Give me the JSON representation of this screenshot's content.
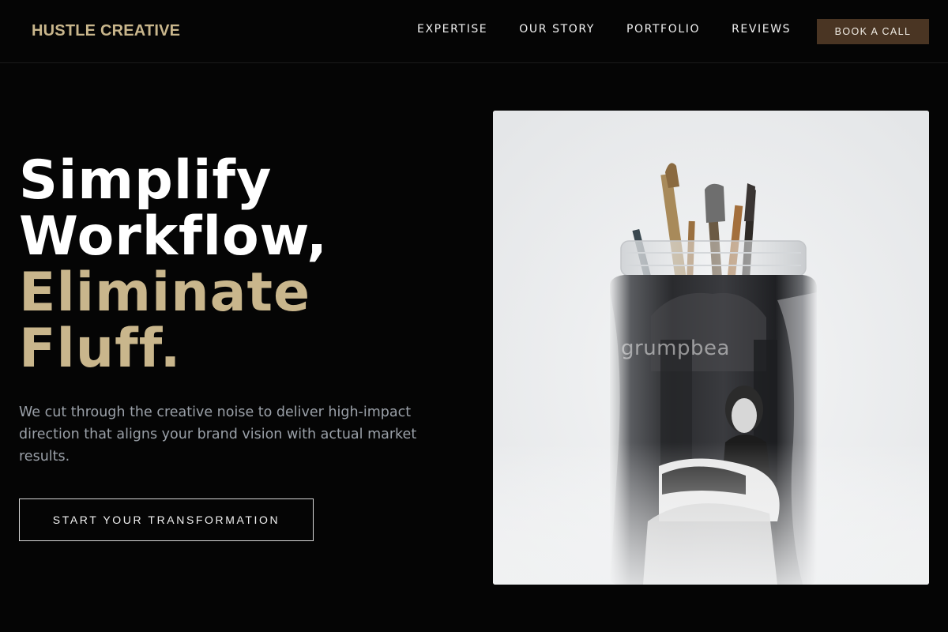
{
  "brand": {
    "name": "HUSTLE CREATIVE",
    "accent": "#c9b68c",
    "button_color": "#4a3523"
  },
  "nav": {
    "items": [
      {
        "label": "EXPERTISE"
      },
      {
        "label": "OUR STORY"
      },
      {
        "label": "PORTFOLIO"
      },
      {
        "label": "REVIEWS"
      }
    ],
    "cta_label": "BOOK A CALL"
  },
  "hero": {
    "title_lines": [
      {
        "text": "Simplify",
        "color": "white"
      },
      {
        "text": "Workflow,",
        "color": "white"
      },
      {
        "text": "Eliminate",
        "color": "gold"
      },
      {
        "text": "Fluff.",
        "color": "gold"
      }
    ],
    "description": "We cut through the creative noise to deliver high-impact direction that aligns your brand vision with actual market results.",
    "cta_label": "START YOUR TRANSFORMATION",
    "image": {
      "subject": "glass-jar-with-paintbrushes-photo",
      "watermark": "grumpbea"
    }
  }
}
